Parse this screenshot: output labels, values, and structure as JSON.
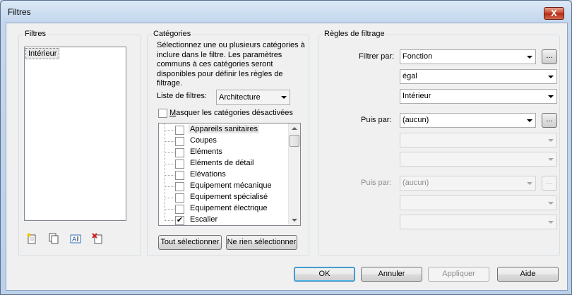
{
  "window": {
    "title": "Filtres",
    "close_glyph": "X"
  },
  "filters_panel": {
    "label": "Filtres",
    "items": [
      "Intérieur"
    ],
    "toolbar_icons": [
      "new-filter-icon",
      "duplicate-filter-icon",
      "rename-filter-icon",
      "delete-filter-icon"
    ]
  },
  "categories_panel": {
    "label": "Catégories",
    "description": "Sélectionnez une ou plusieurs catégories à inclure dans le filtre. Les paramètres communs à ces catégories seront disponibles pour définir les règles de filtrage.",
    "filter_list_label": "Liste de filtres:",
    "filter_list_value": "Architecture",
    "hide_disabled_label": "Masquer les catégories désactivées",
    "hide_disabled_checked": false,
    "items": [
      {
        "label": "Appareils sanitaires",
        "checked": false
      },
      {
        "label": "Coupes",
        "checked": false
      },
      {
        "label": "Eléments",
        "checked": false
      },
      {
        "label": "Eléments de détail",
        "checked": false
      },
      {
        "label": "Elévations",
        "checked": false
      },
      {
        "label": "Equipement mécanique",
        "checked": false
      },
      {
        "label": "Equipement spécialisé",
        "checked": false
      },
      {
        "label": "Equipement électrique",
        "checked": false
      },
      {
        "label": "Escalier",
        "checked": true
      }
    ],
    "select_all_label": "Tout sélectionner",
    "select_none_label": "Ne rien sélectionner"
  },
  "rules_panel": {
    "label": "Règles de filtrage",
    "filter_by_label": "Filtrer par:",
    "filter_by_value": "Fonction",
    "operator_value": "égal",
    "value_value": "Intérieur",
    "then_by_label": "Puis par:",
    "then_by_value": "(aucun)",
    "then_by2_label": "Puis par:",
    "then_by2_value": "(aucun)",
    "ellipsis": "..."
  },
  "footer": {
    "ok_label": "OK",
    "cancel_label": "Annuler",
    "apply_label": "Appliquer",
    "help_label": "Aide"
  }
}
